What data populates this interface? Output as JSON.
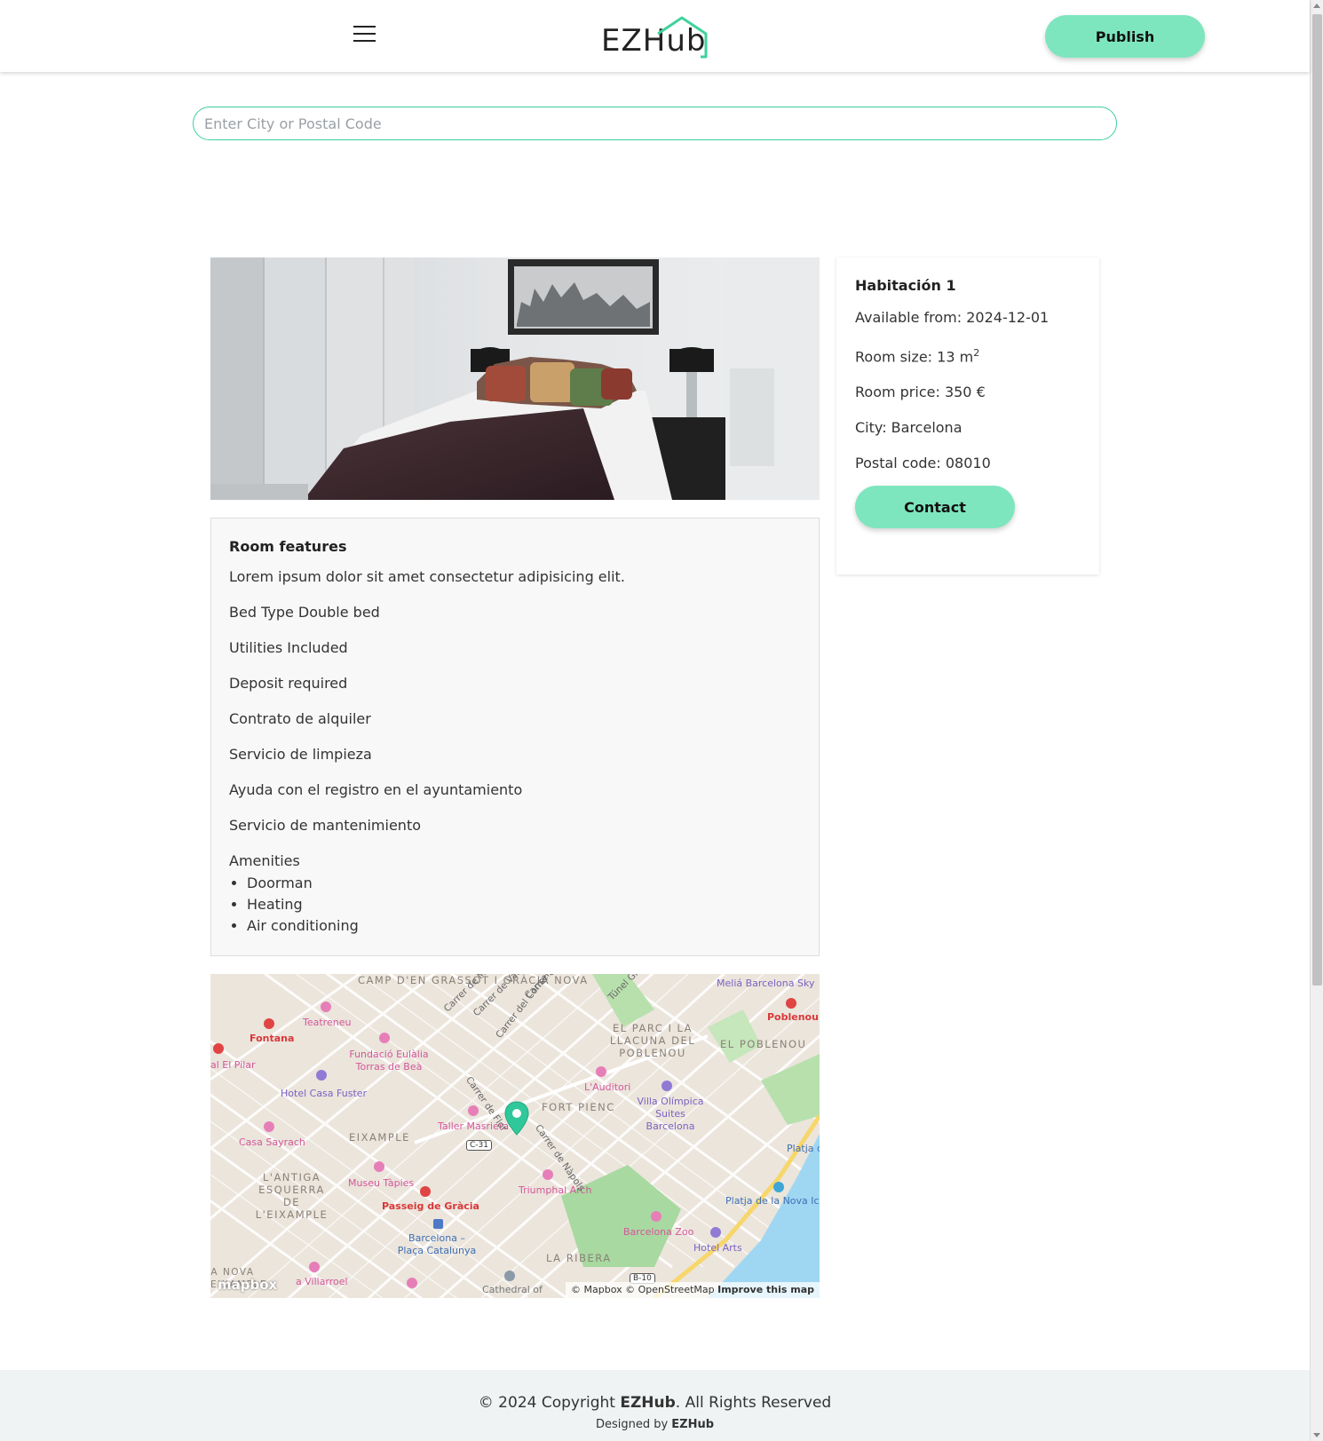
{
  "header": {
    "logo_text": "EZHub",
    "publish_label": "Publish"
  },
  "search": {
    "placeholder": "Enter City or Postal Code",
    "value": ""
  },
  "room": {
    "title": "Habitación 1",
    "available_from": "Available from: 2024-12-01",
    "room_size_prefix": "Room size: 13 m",
    "room_size_sup": "2",
    "room_price": "Room price: 350 €",
    "city": "City: Barcelona",
    "postal_code": "Postal code: 08010",
    "contact_label": "Contact"
  },
  "features": {
    "title": "Room features",
    "items": [
      "Lorem ipsum dolor sit amet consectetur adipisicing elit.",
      "Bed Type Double bed",
      "Utilities Included",
      "Deposit required",
      "Contrato de alquiler",
      "Servicio de limpieza",
      "Ayuda con el registro en el ayuntamiento",
      "Servicio de mantenimiento"
    ],
    "amenities_title": "Amenities",
    "amenities": [
      "Doorman",
      "Heating",
      "Air conditioning"
    ]
  },
  "map": {
    "districts": {
      "camp": "CAMP D'EN GRASSOT I GRÀCIA NOVA",
      "parc": "EL PARC I LA LLACUNA DEL POBLENOU",
      "poblenou": "EL POBLENOU",
      "fort_pienc": "FORT PIENC",
      "eixample": "EIXAMPLE",
      "antiga": "L'ANTIGA ESQUERRA DE L'EIXAMPLE",
      "ribera": "LA RIBERA",
      "nova": "A NOVA EIXAMPLE"
    },
    "pois": {
      "melia": "Meliá Barcelona Sky",
      "poblenou_metro": "Poblenou",
      "teatreneu": "Teatreneu",
      "fontana": "Fontana",
      "fundacio": "Fundació Eulàlia Torras de Beà",
      "pilar": "al El Pilar",
      "casa_fuster": "Hotel Casa Fuster",
      "auditori": "L'Auditori",
      "villa": "Villa Olímpica Suites Barcelona",
      "masriera": "Taller Masriera",
      "sayrach": "Casa Sayrach",
      "platja": "Platja d",
      "tapies": "Museu Tàpies",
      "passeig": "Passeig de Gràcia",
      "triumphal": "Triumphal Arch",
      "nova_icaria": "Platja de la Nova Icar",
      "zoo": "Barcelona Zoo",
      "hotel_arts": "Hotel Arts",
      "catalunya": "Barcelona – Plaça Catalunya",
      "villarroel": "a Villarroel",
      "cathedral": "Cathedral of"
    },
    "streets": {
      "mallorca": "Carrer de Mallorca",
      "valencia": "Carrer de València",
      "arago": "Carrer d'Ara",
      "consell": "Carrer del Consell de Cent",
      "tunel": "Túnel Gl",
      "flor": "Carrer de Flor",
      "napols": "Carrer de Nàpols",
      "c31": "C-31",
      "b10": "B-10"
    },
    "attribution_mapbox": "© Mapbox",
    "attribution_osm": "© OpenStreetMap",
    "attribution_improve": "Improve this map",
    "logo": "mapbox"
  },
  "footer": {
    "copyright_prefix": "© 2024 Copyright ",
    "copyright_brand": "EZHub",
    "copyright_suffix": ". All Rights Reserved",
    "designed_prefix": "Designed by ",
    "designed_brand": "EZHub"
  },
  "colors": {
    "accent": "#7ee6bf",
    "accent_border": "#3fcf9c",
    "map_pin": "#2fc89a",
    "footer_bg": "#eff3f3"
  }
}
